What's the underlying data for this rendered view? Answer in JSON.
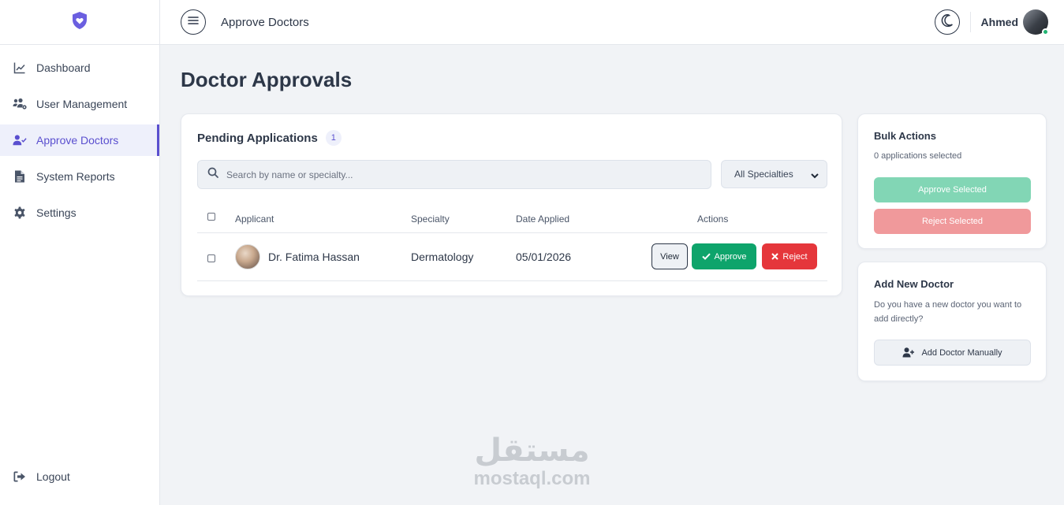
{
  "header": {
    "title": "Approve Doctors",
    "user_name": "Ahmed"
  },
  "sidebar": {
    "items": [
      {
        "label": "Dashboard",
        "icon": "chart-line-icon"
      },
      {
        "label": "User Management",
        "icon": "users-cog-icon"
      },
      {
        "label": "Approve Doctors",
        "icon": "user-check-icon",
        "active": true
      },
      {
        "label": "System Reports",
        "icon": "file-report-icon"
      },
      {
        "label": "Settings",
        "icon": "gear-icon"
      }
    ],
    "logout_label": "Logout"
  },
  "main": {
    "page_title": "Doctor Approvals",
    "pending": {
      "title": "Pending Applications",
      "count": "1",
      "search_placeholder": "Search by name or specialty...",
      "specialty_filter": "All Specialties",
      "columns": {
        "applicant": "Applicant",
        "specialty": "Specialty",
        "date": "Date Applied",
        "actions": "Actions"
      },
      "rows": [
        {
          "name": "Dr. Fatima Hassan",
          "specialty": "Dermatology",
          "date": "05/01/2026"
        }
      ],
      "view_label": "View",
      "approve_label": "Approve",
      "reject_label": "Reject"
    },
    "bulk": {
      "title": "Bulk Actions",
      "selected_text": "0 applications selected",
      "approve_selected": "Approve Selected",
      "reject_selected": "Reject Selected"
    },
    "add_doctor": {
      "title": "Add New Doctor",
      "description": "Do you have a new doctor you want to add directly?",
      "button": "Add Doctor Manually"
    }
  },
  "watermark": {
    "arabic": "مستقل",
    "latin": "mostaql.com"
  },
  "colors": {
    "accent": "#5a4fcf",
    "approve": "#0ea46b",
    "reject": "#e5363b",
    "online": "#22b573"
  }
}
